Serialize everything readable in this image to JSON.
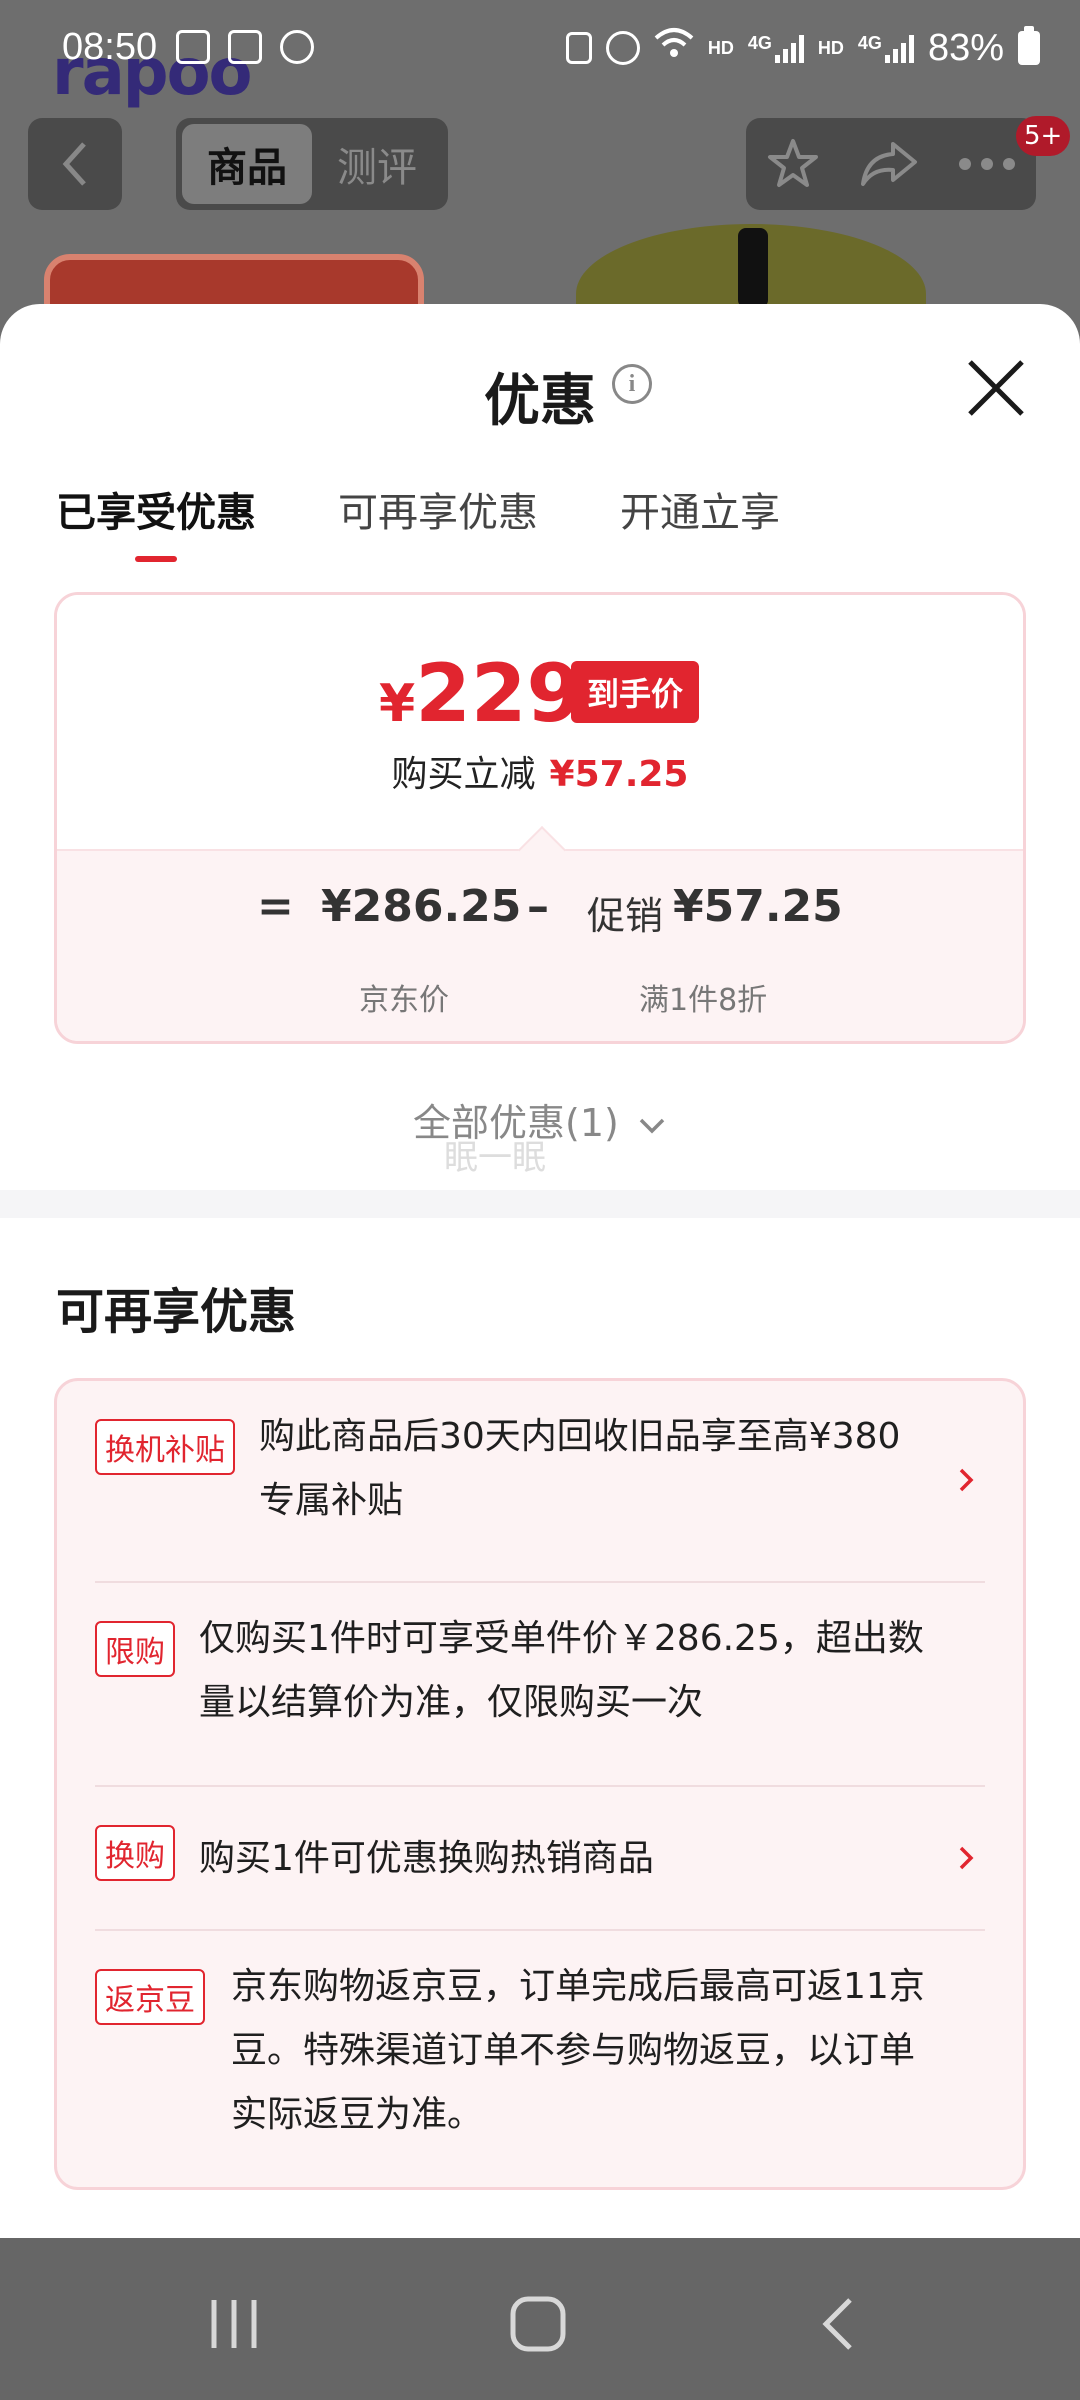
{
  "status_bar": {
    "time": "08:50",
    "hd1": "HD",
    "net1": "4G",
    "hd2": "HD",
    "net2": "4G",
    "battery": "83%"
  },
  "background_page": {
    "brand_logo": "rapoo",
    "tabs": [
      "商品",
      "测评"
    ],
    "active_tab": "商品",
    "cart_badge": "5+"
  },
  "sheet": {
    "title": "优惠",
    "tabs": [
      "已享受优惠",
      "可再享优惠",
      "开通立享"
    ],
    "active_tab": 0,
    "final_price": {
      "currency": "¥",
      "amount": "229",
      "tag": "到手价"
    },
    "reduce": {
      "label": "购买立减",
      "amount": "¥57.25"
    },
    "formula": {
      "equals": "=",
      "base_price": "¥286.25",
      "minus": "–",
      "promo_label": "促销",
      "promo_amount": "¥57.25",
      "base_caption": "京东价",
      "promo_caption": "满1件8折"
    },
    "all_promos": "全部优惠(1)",
    "watermark": "眠一眠",
    "section_title": "可再享优惠",
    "offers": [
      {
        "tag": "换机补贴",
        "line1": "购此商品后30天内回收旧品享至高¥380",
        "line2": "专属补贴",
        "has_chevron": true
      },
      {
        "tag": "限购",
        "line1": "仅购买1件时可享受单件价￥286.25，超出数",
        "line2": "量以结算价为准，仅限购买一次",
        "has_chevron": false
      },
      {
        "tag": "换购",
        "line1": "购买1件可优惠换购热销商品",
        "has_chevron": true
      },
      {
        "tag": "返京豆",
        "line1": "京东购物返京豆，订单完成后最高可返11京",
        "line2": "豆。特殊渠道订单不参与购物返豆，以订单",
        "line3": "实际返豆为准。",
        "has_chevron": false
      }
    ]
  },
  "colors": {
    "accent": "#e1252f",
    "card_bg": "#fdf3f4",
    "card_border": "#f7d3d8",
    "overlay": "#6e6e6e",
    "navbar": "#666666"
  },
  "navbar": {
    "icons": [
      "recent-apps-icon",
      "home-icon",
      "back-icon"
    ]
  }
}
